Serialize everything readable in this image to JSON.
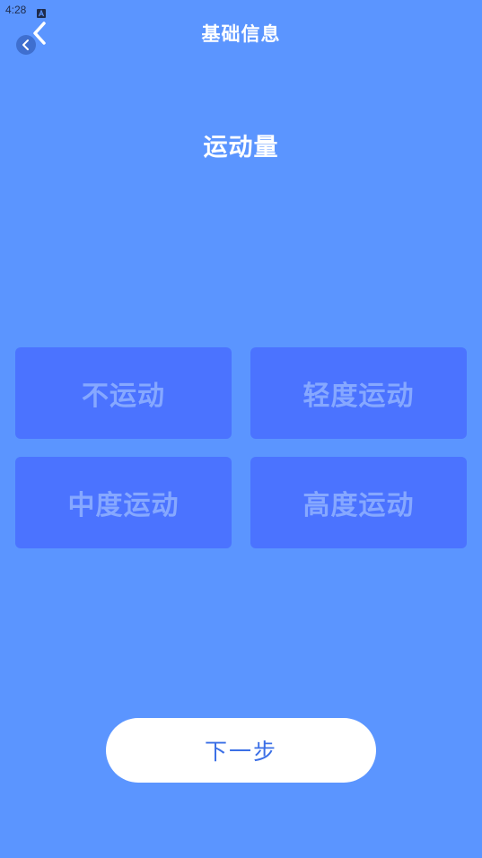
{
  "status_bar": {
    "time": "4:28",
    "notification_icon": "a-icon"
  },
  "header": {
    "title": "基础信息",
    "back_icon": "chevron-left-icon"
  },
  "section": {
    "title": "运动量"
  },
  "options": [
    {
      "label": "不运动"
    },
    {
      "label": "轻度运动"
    },
    {
      "label": "中度运动"
    },
    {
      "label": "高度运动"
    }
  ],
  "next_button": {
    "label": "下一步"
  },
  "colors": {
    "background": "#5b95ff",
    "option_background": "#4b73ff",
    "option_text": "#86a8ff",
    "button_background": "#ffffff",
    "button_text": "#3b6fe6"
  }
}
